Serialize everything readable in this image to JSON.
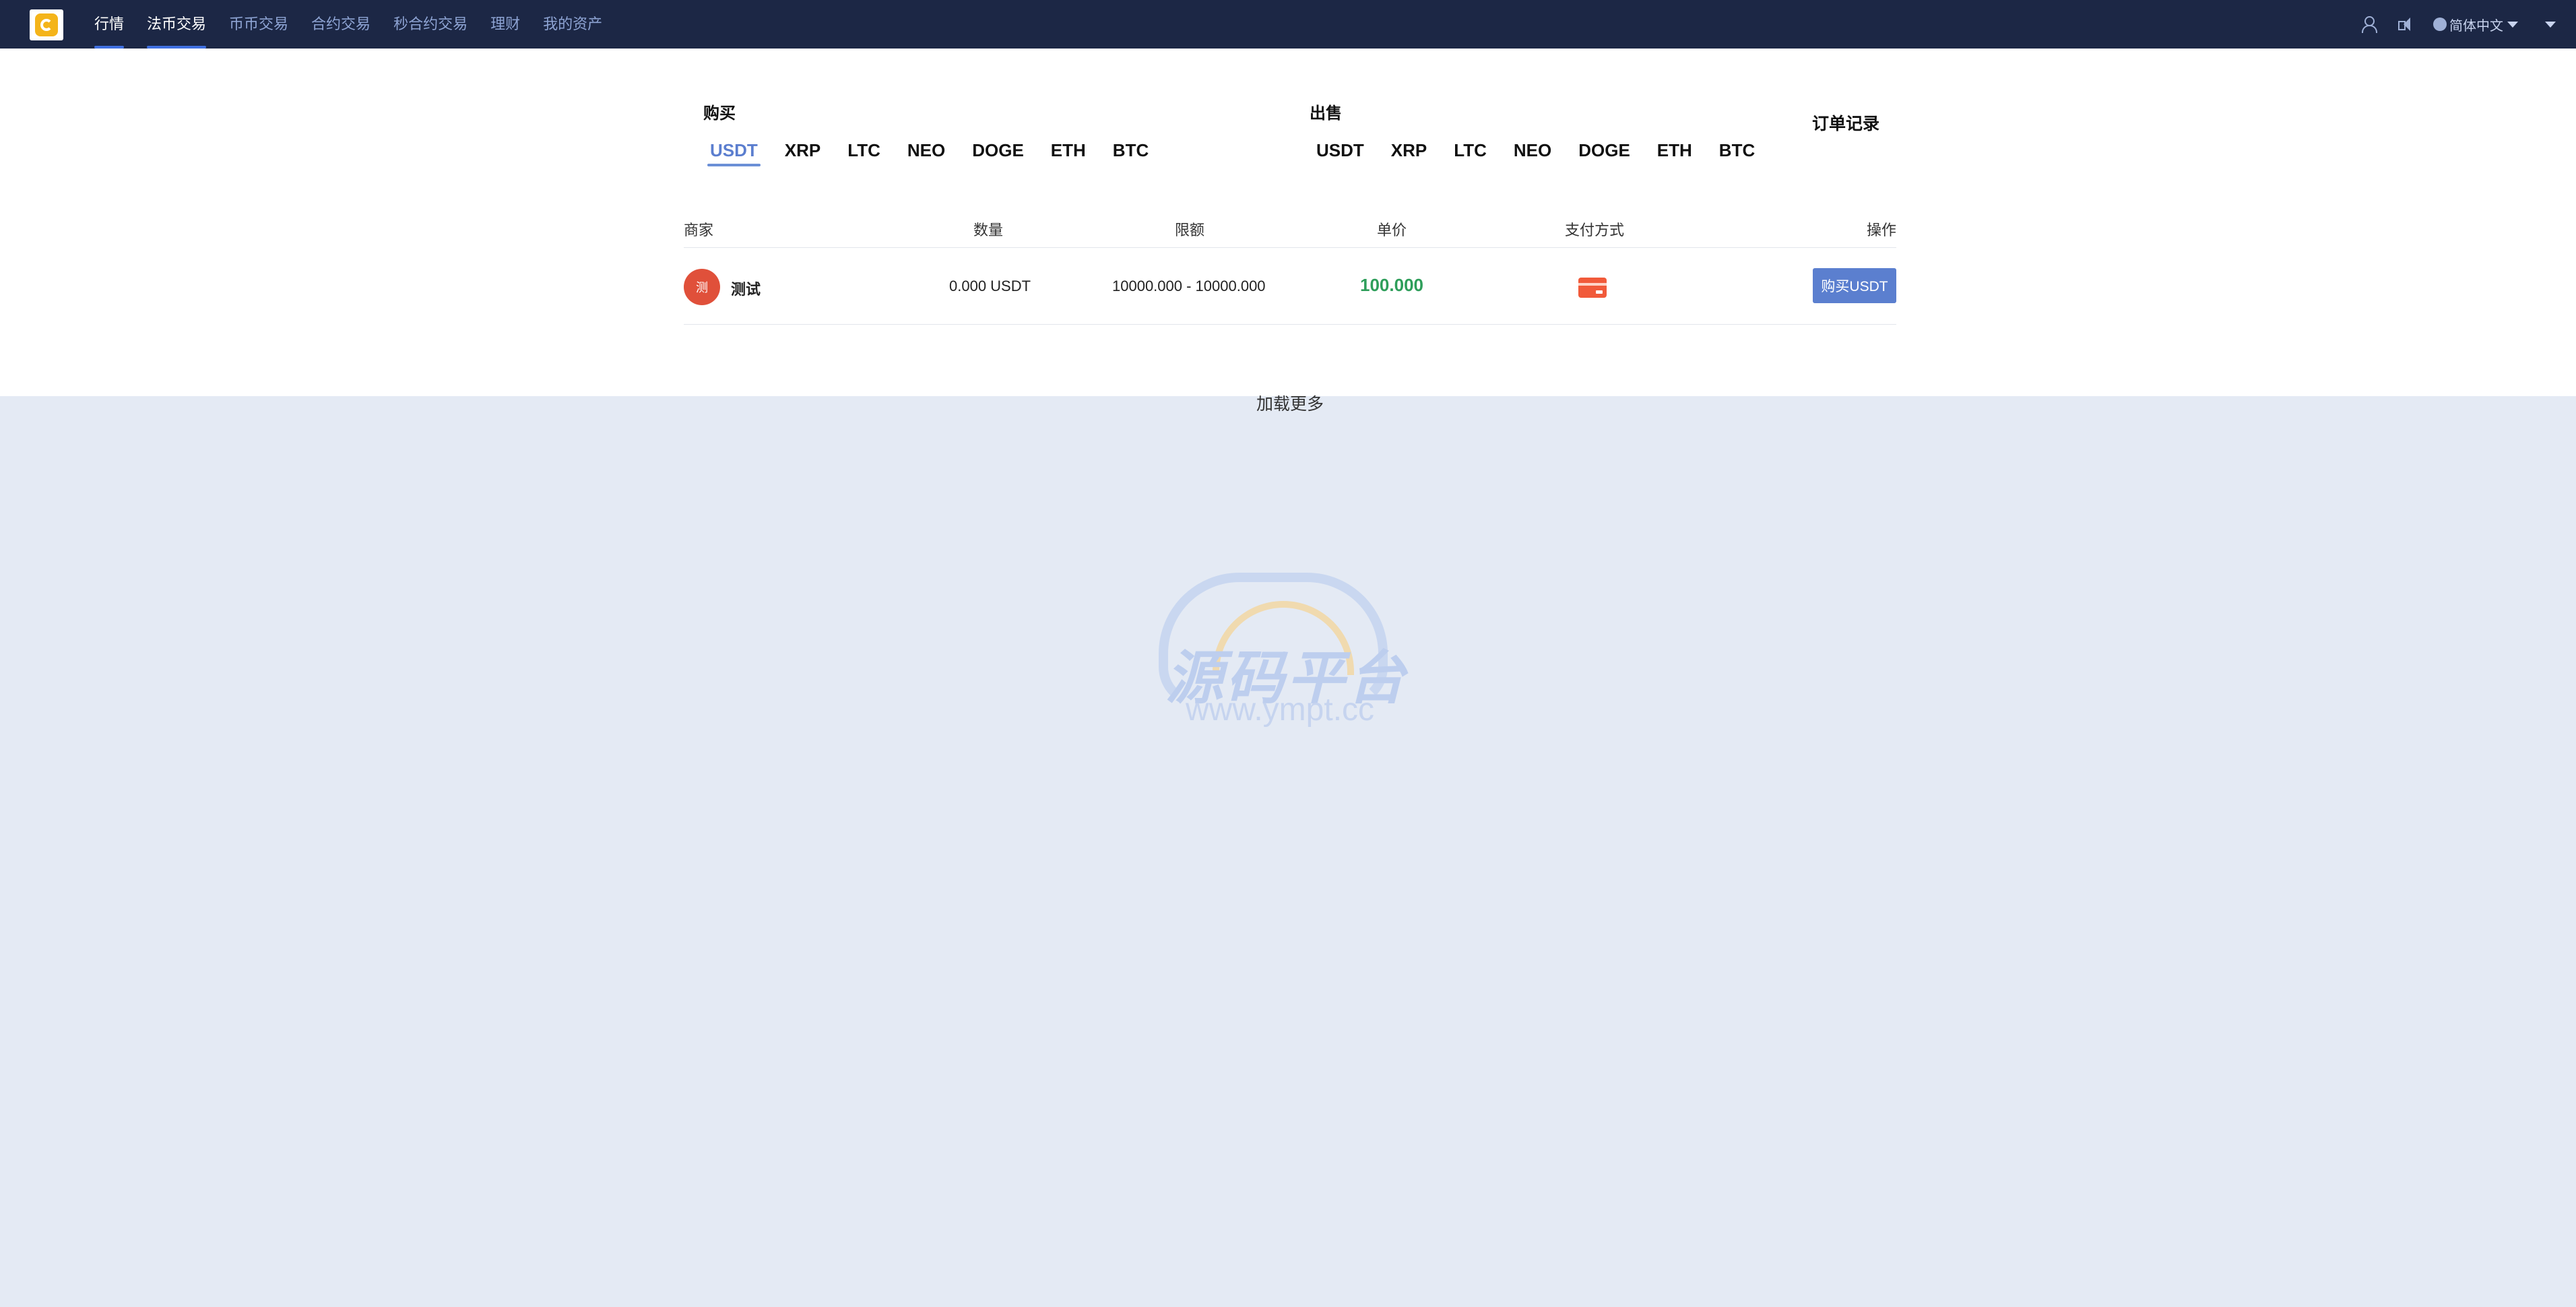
{
  "nav": {
    "items": [
      "行情",
      "法币交易",
      "币币交易",
      "合约交易",
      "秒合约交易",
      "理财",
      "我的资产"
    ],
    "language": "简体中文"
  },
  "buy": {
    "title": "购买",
    "coins": [
      "USDT",
      "XRP",
      "LTC",
      "NEO",
      "DOGE",
      "ETH",
      "BTC"
    ],
    "active": "USDT"
  },
  "sell": {
    "title": "出售",
    "coins": [
      "USDT",
      "XRP",
      "LTC",
      "NEO",
      "DOGE",
      "ETH",
      "BTC"
    ]
  },
  "order_record": "订单记录",
  "table": {
    "headers": [
      "商家",
      "数量",
      "限额",
      "单价",
      "支付方式",
      "操作"
    ],
    "rows": [
      {
        "avatar": "测",
        "merchant": "测试",
        "quantity": "0.000 USDT",
        "limit": "10000.000 - 10000.000",
        "price": "100.000",
        "payment": "bank-card",
        "action": "购买USDT"
      }
    ]
  },
  "load_more": "加载更多",
  "watermark": {
    "title": "源码平台",
    "url": "www.ympt.cc"
  },
  "colors": {
    "nav_bg": "#1c2745",
    "accent": "#5b7fcf",
    "price": "#2e9e5a",
    "page_bg": "#e4eaf4"
  }
}
